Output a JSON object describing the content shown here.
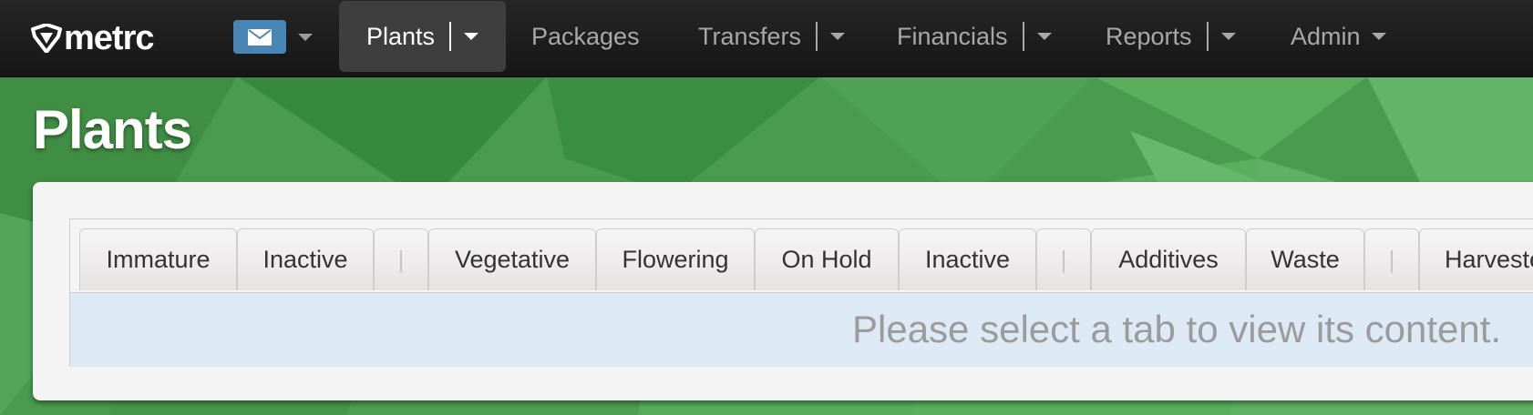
{
  "app": {
    "logo_text": "metrc"
  },
  "navbar": {
    "items": [
      {
        "label": "Plants",
        "active": true,
        "has_dropdown": true
      },
      {
        "label": "Packages",
        "active": false,
        "has_dropdown": false
      },
      {
        "label": "Transfers",
        "active": false,
        "has_dropdown": true
      },
      {
        "label": "Financials",
        "active": false,
        "has_dropdown": true
      },
      {
        "label": "Reports",
        "active": false,
        "has_dropdown": true
      },
      {
        "label": "Admin",
        "active": false,
        "has_dropdown": true
      }
    ],
    "mail_icon": "envelope-icon"
  },
  "page": {
    "title": "Plants"
  },
  "tabs": [
    {
      "label": "Immature"
    },
    {
      "label": "Inactive"
    },
    {
      "label": "|"
    },
    {
      "label": "Vegetative"
    },
    {
      "label": "Flowering"
    },
    {
      "label": "On Hold"
    },
    {
      "label": "Inactive"
    },
    {
      "label": "|"
    },
    {
      "label": "Additives"
    },
    {
      "label": "Waste"
    },
    {
      "label": "|"
    },
    {
      "label": "Harvested"
    }
  ],
  "content": {
    "empty_message": "Please select a tab to view its content."
  },
  "colors": {
    "accent_mail": "#4a86b5",
    "navbar": "#1c1c1c",
    "background_green": "#4a9a4d",
    "content_bg": "#ddeaf6"
  }
}
